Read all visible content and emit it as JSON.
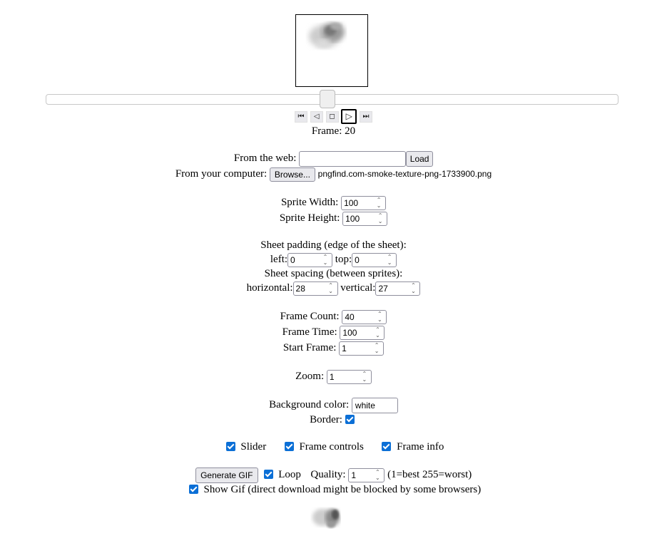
{
  "preview": {
    "frame_label": "Frame:",
    "frame_number": "20",
    "slider_value_fraction": 0.49
  },
  "playback": {
    "first_icon": "skip-to-first-icon",
    "prev_icon": "step-back-icon",
    "stop_icon": "stop-icon",
    "play_icon": "play-icon",
    "last_icon": "skip-to-last-icon"
  },
  "source": {
    "web_label": "From the web:",
    "web_value": "",
    "load_label": "Load",
    "computer_label": "From your computer:",
    "browse_label": "Browse...",
    "file_name": "pngfind.com-smoke-texture-png-1733900.png"
  },
  "sprite": {
    "width_label": "Sprite Width:",
    "width_value": "100",
    "height_label": "Sprite Height:",
    "height_value": "100"
  },
  "padding": {
    "heading": "Sheet padding (edge of the sheet):",
    "left_label": "left:",
    "left_value": "0",
    "top_label": "top:",
    "top_value": "0"
  },
  "spacing": {
    "heading": "Sheet spacing (between sprites):",
    "horizontal_label": "horizontal:",
    "horizontal_value": "28",
    "vertical_label": "vertical:",
    "vertical_value": "27"
  },
  "frames": {
    "count_label": "Frame Count:",
    "count_value": "40",
    "time_label": "Frame Time:",
    "time_value": "100",
    "start_label": "Start Frame:",
    "start_value": "1"
  },
  "zoom": {
    "label": "Zoom:",
    "value": "1"
  },
  "appearance": {
    "bg_label": "Background color:",
    "bg_value": "white",
    "border_label": "Border:",
    "border_checked": true
  },
  "options": {
    "slider_label": "Slider",
    "controls_label": "Frame controls",
    "info_label": "Frame info"
  },
  "gif": {
    "generate_label": "Generate GIF",
    "loop_label": "Loop",
    "quality_label": "Quality:",
    "quality_value": "1",
    "quality_hint": "(1=best 255=worst)",
    "show_label": "Show Gif (direct download might be blocked by some browsers)"
  },
  "colors": {
    "checkbox": "#0b6fd6",
    "button_bg": "#e9e9ed",
    "input_border": "#8f8f9d"
  }
}
